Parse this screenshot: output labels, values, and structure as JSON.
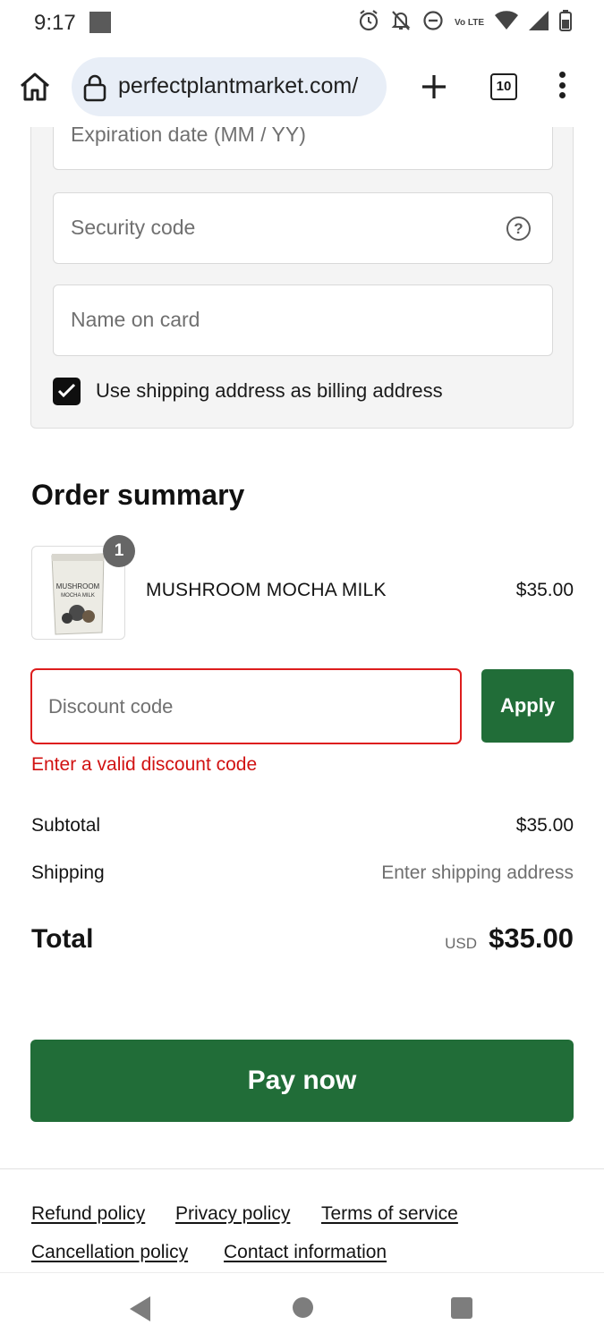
{
  "status_bar": {
    "time": "9:17",
    "icons": [
      "alarm-icon",
      "notifications-off-icon",
      "do-not-disturb-icon",
      "volte-icon",
      "wifi-icon",
      "signal-icon",
      "battery-icon"
    ],
    "volte_text": "Vo LTE"
  },
  "browser": {
    "url": "perfectplantmarket.com/",
    "tab_count": "10"
  },
  "payment": {
    "expiration_placeholder": "Expiration date (MM / YY)",
    "security_placeholder": "Security code",
    "name_placeholder": "Name on card",
    "billing_checkbox_label": "Use shipping address as billing address",
    "billing_checked": true
  },
  "order_summary": {
    "heading": "Order summary",
    "item": {
      "name": "MUSHROOM MOCHA MILK",
      "price": "$35.00",
      "quantity": "1",
      "image_text_line1": "MUSHROOM",
      "image_text_line2": "MOCHA MILK"
    },
    "discount_placeholder": "Discount code",
    "apply_label": "Apply",
    "discount_error": "Enter a valid discount code",
    "subtotal_label": "Subtotal",
    "subtotal_value": "$35.00",
    "shipping_label": "Shipping",
    "shipping_value": "Enter shipping address",
    "total_label": "Total",
    "total_currency": "USD",
    "total_value": "$35.00"
  },
  "pay_button_label": "Pay now",
  "footer_links": {
    "refund": "Refund policy",
    "privacy": "Privacy policy",
    "terms": "Terms of service",
    "cancellation": "Cancellation policy",
    "contact": "Contact information"
  },
  "colors": {
    "brand_green": "#216d38",
    "error_red": "#dd1d1d",
    "url_bar_bg": "#e8eef7"
  }
}
